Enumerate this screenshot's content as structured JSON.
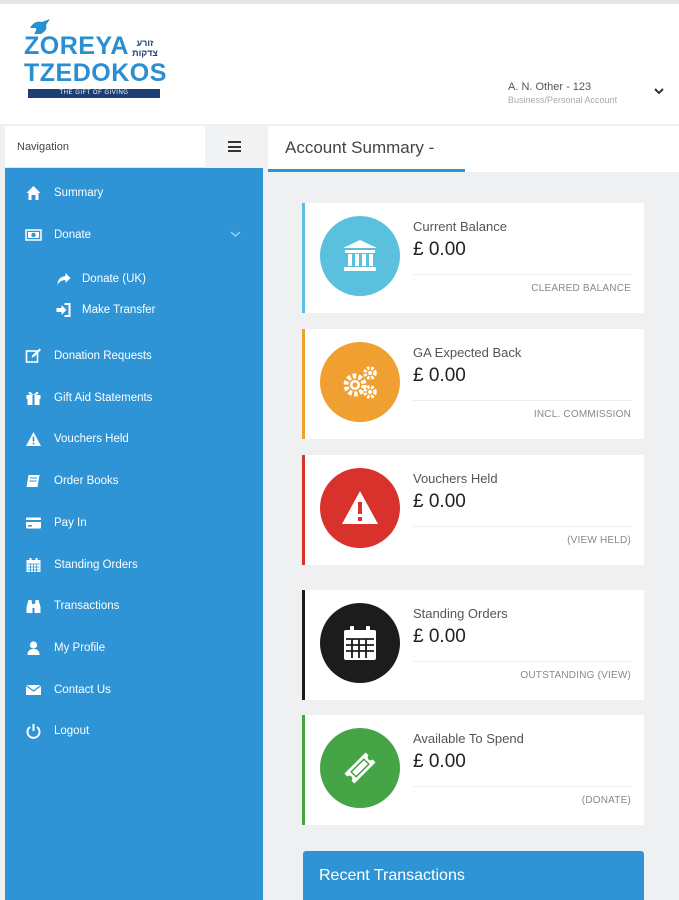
{
  "logo": {
    "line1": "ZOREYA",
    "line2": "TZEDOKOS",
    "hebrew_top": "זורע",
    "hebrew_bottom": "צדקות",
    "tagline": "THE GIFT OF GIVING"
  },
  "user": {
    "name": "A. N. Other - 123",
    "type": "Business/Personal Account"
  },
  "navigation": {
    "label": "Navigation",
    "items": [
      {
        "label": "Summary",
        "icon": "home-icon"
      },
      {
        "label": "Donate",
        "icon": "money-icon"
      },
      {
        "label": "Donate (UK)",
        "icon": "share-arrow-icon"
      },
      {
        "label": "Make Transfer",
        "icon": "sign-in-icon"
      },
      {
        "label": "Donation Requests",
        "icon": "edit-icon"
      },
      {
        "label": "Gift Aid Statements",
        "icon": "gift-icon"
      },
      {
        "label": "Vouchers Held",
        "icon": "warning-icon"
      },
      {
        "label": "Order Books",
        "icon": "book-icon"
      },
      {
        "label": "Pay In",
        "icon": "credit-card-icon"
      },
      {
        "label": "Standing Orders",
        "icon": "calendar-icon"
      },
      {
        "label": "Transactions",
        "icon": "binoculars-icon"
      },
      {
        "label": "My Profile",
        "icon": "user-icon"
      },
      {
        "label": "Contact Us",
        "icon": "envelope-icon"
      },
      {
        "label": "Logout",
        "icon": "power-icon"
      }
    ]
  },
  "page": {
    "title": "Account Summary -"
  },
  "cards": [
    {
      "label": "Current Balance",
      "value": "£ 0.00",
      "footer": "CLEARED BALANCE",
      "color": "#5bc0de",
      "icon": "bank-icon"
    },
    {
      "label": "GA Expected Back",
      "value": "£ 0.00",
      "footer": "INCL. COMMISSION",
      "color": "#f0a030",
      "icon": "gears-icon"
    },
    {
      "label": "Vouchers Held",
      "value": "£ 0.00",
      "footer": "(VIEW HELD)",
      "color": "#d9312b",
      "icon": "warning-icon"
    },
    {
      "label": "Standing Orders",
      "value": "£ 0.00",
      "footer": "OUTSTANDING (VIEW)",
      "color": "#1c1c1c",
      "icon": "calendar-icon"
    },
    {
      "label": "Available To Spend",
      "value": "£ 0.00",
      "footer": "(DONATE)",
      "color": "#45a546",
      "icon": "ticket-icon"
    }
  ],
  "recent_transactions": {
    "title": "Recent Transactions"
  }
}
